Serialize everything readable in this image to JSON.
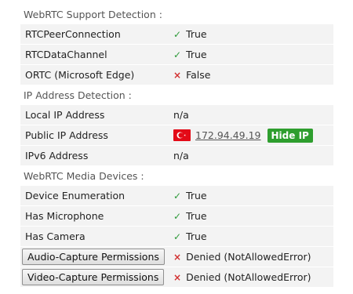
{
  "support": {
    "title": "WebRTC Support Detection :",
    "rows": [
      {
        "label": "RTCPeerConnection",
        "value": "True",
        "status": "ok"
      },
      {
        "label": "RTCDataChannel",
        "value": "True",
        "status": "ok"
      },
      {
        "label": "ORTC (Microsoft Edge)",
        "value": "False",
        "status": "fail"
      }
    ]
  },
  "ip": {
    "title": "IP Address Detection :",
    "local_label": "Local IP Address",
    "local_value": "n/a",
    "public_label": "Public IP Address",
    "public_value": "172.94.49.19",
    "hide_label": "Hide IP",
    "flag_icon": "turkey-flag-icon",
    "ipv6_label": "IPv6 Address",
    "ipv6_value": "n/a"
  },
  "media": {
    "title": "WebRTC Media Devices :",
    "rows": [
      {
        "label": "Device Enumeration",
        "value": "True",
        "status": "ok"
      },
      {
        "label": "Has Microphone",
        "value": "True",
        "status": "ok"
      },
      {
        "label": "Has Camera",
        "value": "True",
        "status": "ok"
      }
    ],
    "audio_button": "Audio-Capture Permissions",
    "audio_value": "Denied (NotAllowedError)",
    "video_button": "Video-Capture Permissions",
    "video_value": "Denied (NotAllowedError)"
  },
  "icons": {
    "check": "✓",
    "cross": "×"
  },
  "colors": {
    "ok": "#2e9a3a",
    "fail": "#d23030",
    "hide_ip_bg": "#2e9e2e",
    "flag": "#e30a17"
  }
}
